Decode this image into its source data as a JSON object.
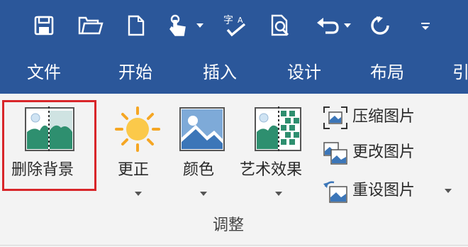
{
  "quick_access": {
    "icons": [
      "save-icon",
      "open-folder-icon",
      "new-document-icon",
      "touch-mode-icon",
      "spelling-check-icon",
      "print-preview-icon",
      "undo-icon",
      "redo-icon",
      "customize-icon"
    ]
  },
  "tabs": [
    "文件",
    "开始",
    "插入",
    "设计",
    "布局",
    "引"
  ],
  "ribbon": {
    "remove_background": "删除背景",
    "corrections": "更正",
    "color": "颜色",
    "artistic_effects": "艺术效果",
    "compress_pictures": "压缩图片",
    "change_picture": "更改图片",
    "reset_picture": "重设图片",
    "group_label": "调整"
  },
  "colors": {
    "title_bar": "#2b579a",
    "ribbon_bg": "#f3f3f3",
    "highlight": "#d8262a"
  }
}
